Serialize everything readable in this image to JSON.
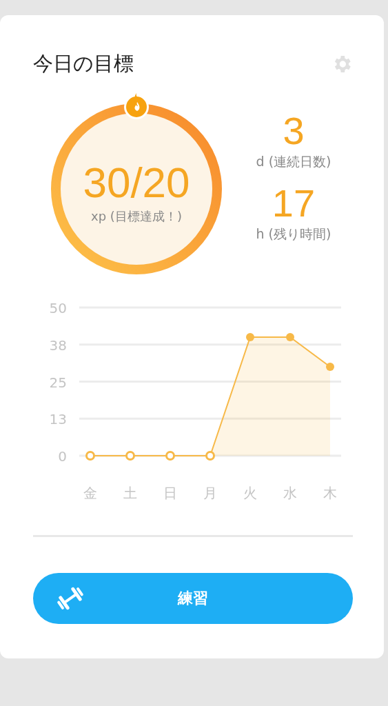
{
  "title": "今日の目標",
  "goal": {
    "value": "30/20",
    "label": "xp (目標達成！)"
  },
  "stats": [
    {
      "value": "3",
      "label": "d (連続日数)"
    },
    {
      "value": "17",
      "label": "h (残り時間)"
    }
  ],
  "chart_data": {
    "type": "area",
    "categories": [
      "金",
      "土",
      "日",
      "月",
      "火",
      "水",
      "木"
    ],
    "series": [
      {
        "color": "#f7b948",
        "values": [
          0,
          0,
          0,
          0,
          40,
          40,
          30
        ]
      }
    ],
    "grid": true,
    "ylim": [
      0,
      50
    ],
    "yticks": [
      0,
      {
        "value": 12.5,
        "label": "13"
      },
      25,
      {
        "value": 37.5,
        "label": "38"
      },
      50
    ]
  },
  "button": {
    "label": "練習"
  }
}
